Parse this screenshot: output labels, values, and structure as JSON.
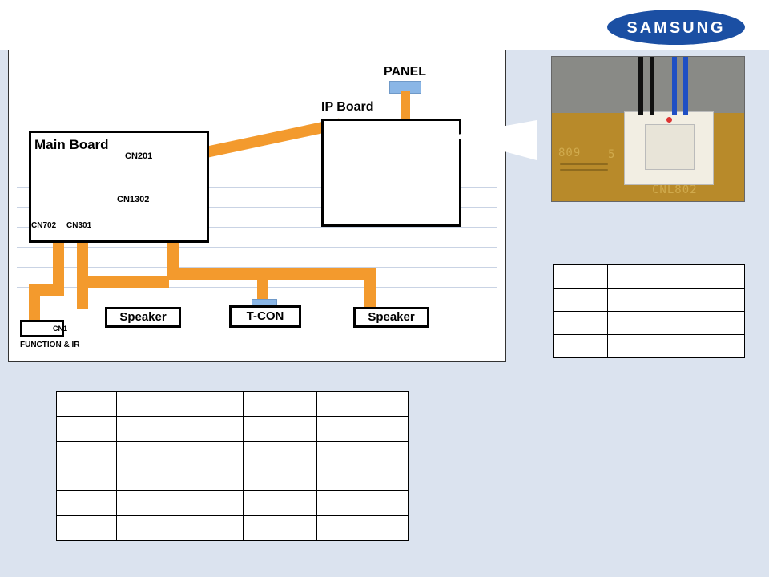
{
  "logo_text": "SAMSUNG",
  "diagram": {
    "main_board": "Main Board",
    "ip_board": "IP Board",
    "panel": "PANEL",
    "tcon": "T-CON",
    "speaker": "Speaker",
    "function_ir": "FUNCTION & IR",
    "cn201": "CN201",
    "cn1302": "CN1302",
    "cn702": "CN702",
    "cn301": "CN301",
    "cn1": "CN1"
  },
  "photo": {
    "silk_cnl": "CNL802",
    "silk_809": "809",
    "silk_5": "5"
  },
  "pin_table": {
    "rows": [
      {
        "c1": "",
        "c2": ""
      },
      {
        "c1": "",
        "c2": ""
      },
      {
        "c1": "",
        "c2": ""
      },
      {
        "c1": "",
        "c2": ""
      }
    ]
  },
  "big_table": {
    "rows": [
      {
        "c1": "",
        "c2": "",
        "c3": "",
        "c4": ""
      },
      {
        "c1": "",
        "c2": "",
        "c3": "",
        "c4": ""
      },
      {
        "c1": "",
        "c2": "",
        "c3": "",
        "c4": ""
      },
      {
        "c1": "",
        "c2": "",
        "c3": "",
        "c4": ""
      },
      {
        "c1": "",
        "c2": "",
        "c3": "",
        "c4": ""
      },
      {
        "c1": "",
        "c2": "",
        "c3": "",
        "c4": ""
      }
    ]
  }
}
